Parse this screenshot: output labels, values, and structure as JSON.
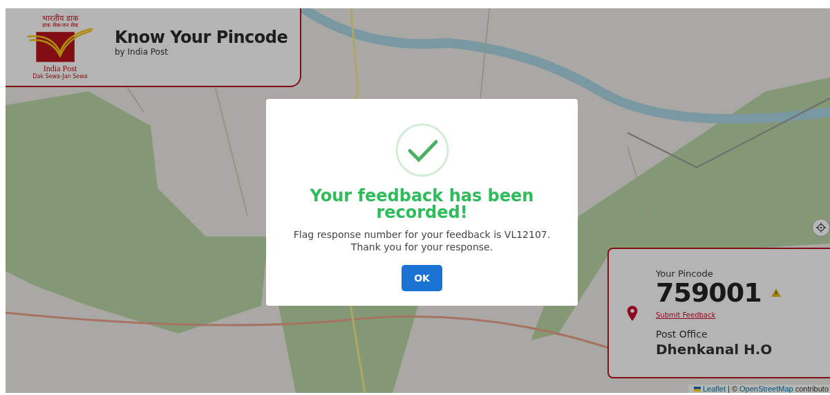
{
  "header": {
    "logo": {
      "hindi": "भारतीय डाक",
      "tagline": "डाक सेवा-जन सेवा",
      "name": "India Post",
      "motto": "Dak Sewa-Jan Sewa"
    },
    "title": "Know Your Pincode",
    "subtitle": "by India Post"
  },
  "pincode_card": {
    "label": "Your Pincode",
    "pincode": "759001",
    "warning": true,
    "link": "Submit Feedback",
    "office_label": "Post Office",
    "office": "Dhenkanal H.O"
  },
  "attribution": {
    "leaflet": "Leaflet",
    "separator": "| ©",
    "osm": "OpenStreetMap",
    "rest": "contributo"
  },
  "dialog": {
    "title": "Your feedback has been recorded!",
    "message": "Flag response number for your feedback is VL12107.",
    "message_2": "Thank you for your response.",
    "button": "OK"
  }
}
